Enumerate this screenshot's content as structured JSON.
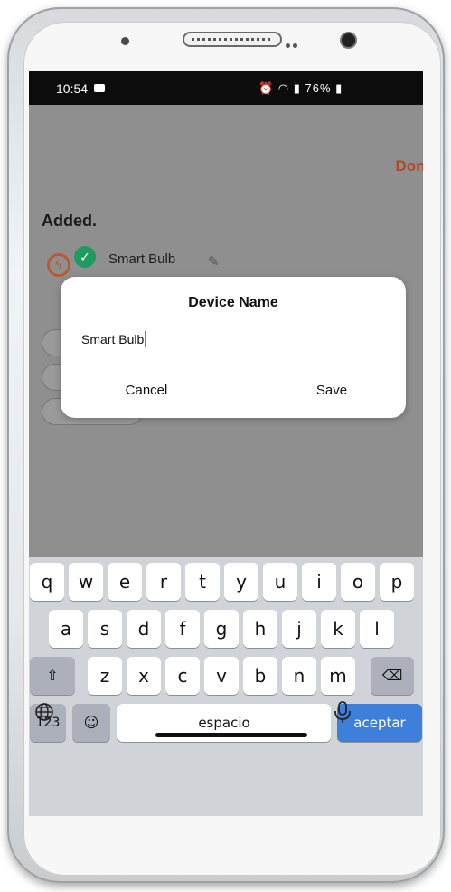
{
  "status_bar": {
    "time": "10:54",
    "right_text": "76%"
  },
  "header": {
    "done_label": "Done"
  },
  "content": {
    "title": "Added.",
    "device_name": "Smart Bulb"
  },
  "dialog": {
    "title": "Device Name",
    "input_value": "Smart Bulb",
    "cancel_label": "Cancel",
    "save_label": "Save"
  },
  "keyboard": {
    "row1": [
      "q",
      "w",
      "e",
      "r",
      "t",
      "y",
      "u",
      "i",
      "o",
      "p"
    ],
    "row2": [
      "a",
      "s",
      "d",
      "f",
      "g",
      "h",
      "j",
      "k",
      "l"
    ],
    "row3": [
      "z",
      "x",
      "c",
      "v",
      "b",
      "n",
      "m"
    ],
    "numbers_label": "123",
    "space_label": "espacio",
    "accept_label": "aceptar"
  },
  "colors": {
    "accent": "#b4482b",
    "keyboard_accept": "#3d7fdb",
    "check": "#1f9a61"
  }
}
